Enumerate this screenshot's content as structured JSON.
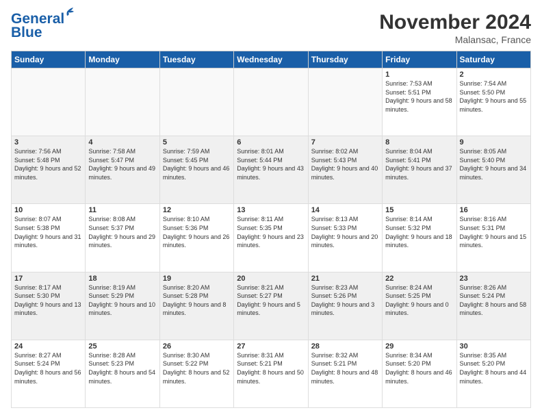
{
  "logo": {
    "line1": "General",
    "line2": "Blue"
  },
  "header": {
    "month": "November 2024",
    "location": "Malansac, France"
  },
  "days_of_week": [
    "Sunday",
    "Monday",
    "Tuesday",
    "Wednesday",
    "Thursday",
    "Friday",
    "Saturday"
  ],
  "weeks": [
    {
      "shaded": false,
      "days": [
        {
          "num": "",
          "info": ""
        },
        {
          "num": "",
          "info": ""
        },
        {
          "num": "",
          "info": ""
        },
        {
          "num": "",
          "info": ""
        },
        {
          "num": "",
          "info": ""
        },
        {
          "num": "1",
          "info": "Sunrise: 7:53 AM\nSunset: 5:51 PM\nDaylight: 9 hours and 58 minutes."
        },
        {
          "num": "2",
          "info": "Sunrise: 7:54 AM\nSunset: 5:50 PM\nDaylight: 9 hours and 55 minutes."
        }
      ]
    },
    {
      "shaded": true,
      "days": [
        {
          "num": "3",
          "info": "Sunrise: 7:56 AM\nSunset: 5:48 PM\nDaylight: 9 hours and 52 minutes."
        },
        {
          "num": "4",
          "info": "Sunrise: 7:58 AM\nSunset: 5:47 PM\nDaylight: 9 hours and 49 minutes."
        },
        {
          "num": "5",
          "info": "Sunrise: 7:59 AM\nSunset: 5:45 PM\nDaylight: 9 hours and 46 minutes."
        },
        {
          "num": "6",
          "info": "Sunrise: 8:01 AM\nSunset: 5:44 PM\nDaylight: 9 hours and 43 minutes."
        },
        {
          "num": "7",
          "info": "Sunrise: 8:02 AM\nSunset: 5:43 PM\nDaylight: 9 hours and 40 minutes."
        },
        {
          "num": "8",
          "info": "Sunrise: 8:04 AM\nSunset: 5:41 PM\nDaylight: 9 hours and 37 minutes."
        },
        {
          "num": "9",
          "info": "Sunrise: 8:05 AM\nSunset: 5:40 PM\nDaylight: 9 hours and 34 minutes."
        }
      ]
    },
    {
      "shaded": false,
      "days": [
        {
          "num": "10",
          "info": "Sunrise: 8:07 AM\nSunset: 5:38 PM\nDaylight: 9 hours and 31 minutes."
        },
        {
          "num": "11",
          "info": "Sunrise: 8:08 AM\nSunset: 5:37 PM\nDaylight: 9 hours and 29 minutes."
        },
        {
          "num": "12",
          "info": "Sunrise: 8:10 AM\nSunset: 5:36 PM\nDaylight: 9 hours and 26 minutes."
        },
        {
          "num": "13",
          "info": "Sunrise: 8:11 AM\nSunset: 5:35 PM\nDaylight: 9 hours and 23 minutes."
        },
        {
          "num": "14",
          "info": "Sunrise: 8:13 AM\nSunset: 5:33 PM\nDaylight: 9 hours and 20 minutes."
        },
        {
          "num": "15",
          "info": "Sunrise: 8:14 AM\nSunset: 5:32 PM\nDaylight: 9 hours and 18 minutes."
        },
        {
          "num": "16",
          "info": "Sunrise: 8:16 AM\nSunset: 5:31 PM\nDaylight: 9 hours and 15 minutes."
        }
      ]
    },
    {
      "shaded": true,
      "days": [
        {
          "num": "17",
          "info": "Sunrise: 8:17 AM\nSunset: 5:30 PM\nDaylight: 9 hours and 13 minutes."
        },
        {
          "num": "18",
          "info": "Sunrise: 8:19 AM\nSunset: 5:29 PM\nDaylight: 9 hours and 10 minutes."
        },
        {
          "num": "19",
          "info": "Sunrise: 8:20 AM\nSunset: 5:28 PM\nDaylight: 9 hours and 8 minutes."
        },
        {
          "num": "20",
          "info": "Sunrise: 8:21 AM\nSunset: 5:27 PM\nDaylight: 9 hours and 5 minutes."
        },
        {
          "num": "21",
          "info": "Sunrise: 8:23 AM\nSunset: 5:26 PM\nDaylight: 9 hours and 3 minutes."
        },
        {
          "num": "22",
          "info": "Sunrise: 8:24 AM\nSunset: 5:25 PM\nDaylight: 9 hours and 0 minutes."
        },
        {
          "num": "23",
          "info": "Sunrise: 8:26 AM\nSunset: 5:24 PM\nDaylight: 8 hours and 58 minutes."
        }
      ]
    },
    {
      "shaded": false,
      "days": [
        {
          "num": "24",
          "info": "Sunrise: 8:27 AM\nSunset: 5:24 PM\nDaylight: 8 hours and 56 minutes."
        },
        {
          "num": "25",
          "info": "Sunrise: 8:28 AM\nSunset: 5:23 PM\nDaylight: 8 hours and 54 minutes."
        },
        {
          "num": "26",
          "info": "Sunrise: 8:30 AM\nSunset: 5:22 PM\nDaylight: 8 hours and 52 minutes."
        },
        {
          "num": "27",
          "info": "Sunrise: 8:31 AM\nSunset: 5:21 PM\nDaylight: 8 hours and 50 minutes."
        },
        {
          "num": "28",
          "info": "Sunrise: 8:32 AM\nSunset: 5:21 PM\nDaylight: 8 hours and 48 minutes."
        },
        {
          "num": "29",
          "info": "Sunrise: 8:34 AM\nSunset: 5:20 PM\nDaylight: 8 hours and 46 minutes."
        },
        {
          "num": "30",
          "info": "Sunrise: 8:35 AM\nSunset: 5:20 PM\nDaylight: 8 hours and 44 minutes."
        }
      ]
    }
  ]
}
